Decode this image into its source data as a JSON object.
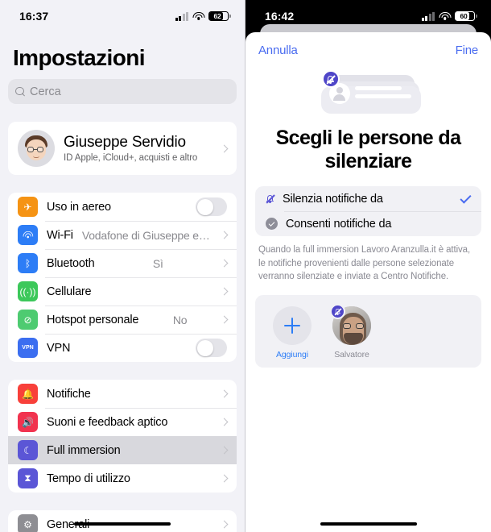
{
  "left": {
    "status": {
      "time": "16:37",
      "battery": "62",
      "signal_icon": "cellular-bars-icon",
      "wifi_icon": "wifi-icon",
      "battery_icon": "battery-icon"
    },
    "title": "Impostazioni",
    "search": {
      "placeholder": "Cerca",
      "icon": "search-icon"
    },
    "profile": {
      "name": "Giuseppe Servidio",
      "subtitle": "ID Apple, iCloud+, acquisti e altro",
      "avatar": "memoji-avatar"
    },
    "group1": [
      {
        "label": "Uso in aereo",
        "icon": "airplane-icon",
        "icon_color": "#f59314",
        "control": "toggle",
        "value": "off"
      },
      {
        "label": "Wi-Fi",
        "icon": "wifi-icon",
        "icon_color": "#2d7df6",
        "control": "chevron",
        "value": "Vodafone di Giuseppe e Sara"
      },
      {
        "label": "Bluetooth",
        "icon": "bluetooth-icon",
        "icon_color": "#2d7df6",
        "control": "chevron",
        "value": "Sì"
      },
      {
        "label": "Cellulare",
        "icon": "cellular-antenna-icon",
        "icon_color": "#3cc85a",
        "control": "chevron",
        "value": ""
      },
      {
        "label": "Hotspot personale",
        "icon": "hotspot-icon",
        "icon_color": "#4ecb71",
        "control": "chevron",
        "value": "No"
      },
      {
        "label": "VPN",
        "icon": "vpn-icon",
        "icon_color": "#3b6ef0",
        "control": "toggle",
        "value": "off"
      }
    ],
    "group2": [
      {
        "label": "Notifiche",
        "icon": "bell-icon",
        "icon_color": "#f8403a",
        "selected": false
      },
      {
        "label": "Suoni e feedback aptico",
        "icon": "speaker-icon",
        "icon_color": "#f1334f",
        "selected": false
      },
      {
        "label": "Full immersion",
        "icon": "moon-icon",
        "icon_color": "#5b56d6",
        "selected": true
      },
      {
        "label": "Tempo di utilizzo",
        "icon": "hourglass-icon",
        "icon_color": "#5b56d6",
        "selected": false
      }
    ],
    "group3": [
      {
        "label": "Generali",
        "icon": "gear-icon",
        "icon_color": "#8e8e93",
        "selected": false
      }
    ],
    "home_indicator": "home-indicator"
  },
  "right": {
    "status": {
      "time": "16:42",
      "battery": "60",
      "signal_icon": "cellular-bars-icon",
      "wifi_icon": "wifi-icon",
      "battery_icon": "battery-icon"
    },
    "nav": {
      "cancel": "Annulla",
      "done": "Fine"
    },
    "illustration": "muted-notifications-illustration",
    "title": "Scegli le persone da silenziare",
    "options": [
      {
        "label": "Silenzia notifiche da",
        "icon": "bell-slash-icon",
        "selected": true
      },
      {
        "label": "Consenti notifiche da",
        "icon": "shield-check-icon",
        "selected": false
      }
    ],
    "note": "Quando la full immersion Lavoro Aranzulla.it è attiva, le notifiche provenienti dalle persone selezionate verranno silenziate e inviate a Centro Notifiche.",
    "people": [
      {
        "name": "Aggiungi",
        "type": "add"
      },
      {
        "name": "Salvatore",
        "type": "contact",
        "badge": "bell-slash-icon"
      }
    ],
    "home_indicator": "home-indicator"
  },
  "colors": {
    "accent_blue": "#2d7df6",
    "link_blue": "#4a6cf0",
    "purple": "#4f46c8",
    "page_bg": "#f2f2f7"
  }
}
